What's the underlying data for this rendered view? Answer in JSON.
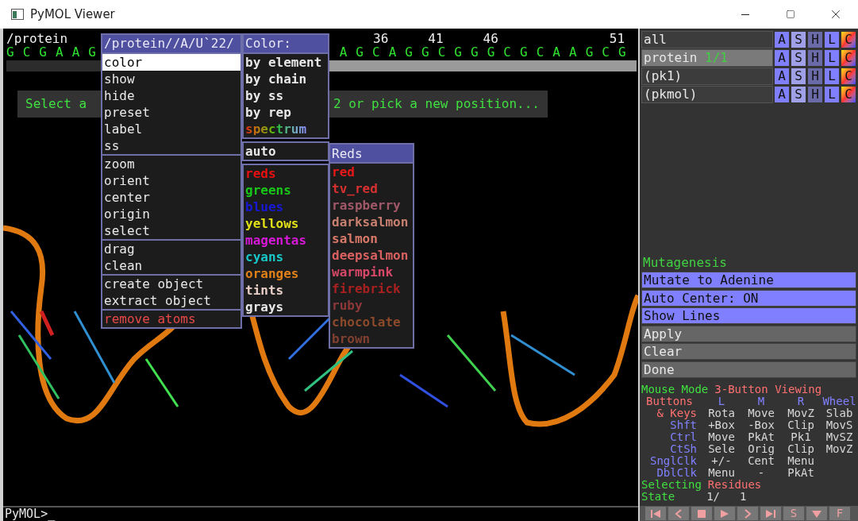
{
  "window": {
    "title": "PyMOL Viewer"
  },
  "sequence": {
    "object": "/protein",
    "ticks": [
      "36",
      "41",
      "46",
      "51"
    ],
    "residues_left": "G C G A A G",
    "residues_right": "A G C A G G C G G G C G C A A G C G"
  },
  "prompt": {
    "before": "Select a",
    "after": "2 or pick a new position..."
  },
  "context_menu": {
    "title": "/protein//A/U`22/",
    "groups": [
      [
        {
          "label": "color",
          "selected": true,
          "kind": "normal"
        },
        {
          "label": "show",
          "selected": false,
          "kind": "normal"
        },
        {
          "label": "hide",
          "selected": false,
          "kind": "normal"
        },
        {
          "label": "preset",
          "selected": false,
          "kind": "normal"
        },
        {
          "label": "label",
          "selected": false,
          "kind": "normal"
        },
        {
          "label": "ss",
          "selected": false,
          "kind": "normal"
        }
      ],
      [
        {
          "label": "zoom",
          "selected": false,
          "kind": "normal"
        },
        {
          "label": "orient",
          "selected": false,
          "kind": "normal"
        },
        {
          "label": "center",
          "selected": false,
          "kind": "normal"
        },
        {
          "label": "origin",
          "selected": false,
          "kind": "normal"
        },
        {
          "label": "select",
          "selected": false,
          "kind": "normal"
        }
      ],
      [
        {
          "label": "drag",
          "selected": false,
          "kind": "normal"
        },
        {
          "label": "clean",
          "selected": false,
          "kind": "normal"
        }
      ],
      [
        {
          "label": "create object",
          "selected": false,
          "kind": "normal"
        },
        {
          "label": "extract object",
          "selected": false,
          "kind": "normal"
        }
      ],
      [
        {
          "label": "remove atoms",
          "selected": false,
          "kind": "destructive"
        }
      ]
    ]
  },
  "color_menu": {
    "title": "Color:",
    "groups": [
      [
        {
          "label": "by element",
          "kind": "plain",
          "color": "#e8e8e8"
        },
        {
          "label": "by chain",
          "kind": "plain",
          "color": "#e8e8e8"
        },
        {
          "label": "by ss",
          "kind": "plain",
          "color": "#e8e8e8"
        },
        {
          "label": "by rep",
          "kind": "plain",
          "color": "#e8e8e8"
        },
        {
          "label": "spectrum",
          "kind": "spectrum"
        }
      ],
      [
        {
          "label": "auto",
          "kind": "plain",
          "color": "#e8e8e8"
        }
      ],
      [
        {
          "label": "reds",
          "kind": "plain",
          "color": "#e81010"
        },
        {
          "label": "greens",
          "kind": "plain",
          "color": "#18c818"
        },
        {
          "label": "blues",
          "kind": "plain",
          "color": "#1818d8"
        },
        {
          "label": "yellows",
          "kind": "plain",
          "color": "#e0e018"
        },
        {
          "label": "magentas",
          "kind": "plain",
          "color": "#d818d8"
        },
        {
          "label": "cyans",
          "kind": "plain",
          "color": "#18c8c8"
        },
        {
          "label": "oranges",
          "kind": "plain",
          "color": "#e08018"
        },
        {
          "label": "tints",
          "kind": "plain",
          "color": "#e8d0c8"
        },
        {
          "label": "grays",
          "kind": "plain",
          "color": "#e8e8e8"
        }
      ]
    ]
  },
  "reds_menu": {
    "title": "Reds",
    "items": [
      {
        "label": "red",
        "color": "#e81818"
      },
      {
        "label": "tv_red",
        "color": "#d83030"
      },
      {
        "label": "raspberry",
        "color": "#a05868"
      },
      {
        "label": "darksalmon",
        "color": "#c88070"
      },
      {
        "label": "salmon",
        "color": "#d87868"
      },
      {
        "label": "deepsalmon",
        "color": "#d86060"
      },
      {
        "label": "warmpink",
        "color": "#d84868"
      },
      {
        "label": "firebrick",
        "color": "#a82020"
      },
      {
        "label": "ruby",
        "color": "#8c3838"
      },
      {
        "label": "chocolate",
        "color": "#8c4a2a"
      },
      {
        "label": "brown",
        "color": "#804030"
      }
    ]
  },
  "objects": [
    {
      "name": "all",
      "selected": false,
      "buttons": [
        "A",
        "S",
        "H",
        "L",
        "C"
      ]
    },
    {
      "name": "protein",
      "count": "1/1",
      "selected": true,
      "buttons": [
        "A",
        "S",
        "H",
        "L",
        "C"
      ]
    },
    {
      "name": "(pk1)",
      "selected": false,
      "buttons": [
        "A",
        "S",
        "H",
        "L",
        "C"
      ]
    },
    {
      "name": "(pkmol)",
      "selected": false,
      "buttons": [
        "A",
        "S",
        "H",
        "L",
        "C"
      ]
    }
  ],
  "wizard": {
    "title": "Mutagenesis",
    "buttons": [
      {
        "label": "Mutate to Adenine",
        "kind": "option"
      },
      {
        "label": "Auto Center: ON",
        "kind": "option"
      },
      {
        "label": "Show Lines",
        "kind": "option"
      },
      {
        "label": "Apply",
        "kind": "action"
      },
      {
        "label": "Clear",
        "kind": "action"
      },
      {
        "label": "Done",
        "kind": "action"
      }
    ]
  },
  "mouse_mode": {
    "title": "Mouse Mode",
    "mode": "3-Button Viewing",
    "header": {
      "label": "Buttons",
      "columns": [
        "L",
        "M",
        "R",
        "Wheel"
      ]
    },
    "rows": [
      {
        "label": "& Keys",
        "kind": "keys",
        "cells": [
          "Rota",
          "Move",
          "MovZ",
          "Slab"
        ]
      },
      {
        "label": "Shft",
        "kind": "modifier",
        "cells": [
          "+Box",
          "-Box",
          "Clip",
          "MovS"
        ]
      },
      {
        "label": "Ctrl",
        "kind": "modifier",
        "cells": [
          "Move",
          "PkAt",
          "Pk1",
          "MvSZ"
        ]
      },
      {
        "label": "CtSh",
        "kind": "modifier",
        "cells": [
          "Sele",
          "Orig",
          "Clip",
          "MovZ"
        ]
      },
      {
        "label": "SnglClk",
        "kind": "modifier",
        "cells": [
          "+/-",
          "Cent",
          "Menu"
        ]
      },
      {
        "label": "DblClk",
        "kind": "modifier",
        "cells": [
          "Menu",
          "-",
          "PkAt"
        ]
      }
    ],
    "selecting": {
      "label": "Selecting",
      "value": "Residues"
    },
    "state": {
      "label": "State",
      "value": "1/",
      "total": "1"
    }
  },
  "transport": {
    "labels": [
      "S",
      "F"
    ]
  },
  "command_line": {
    "prompt": "PyMOL>_"
  }
}
